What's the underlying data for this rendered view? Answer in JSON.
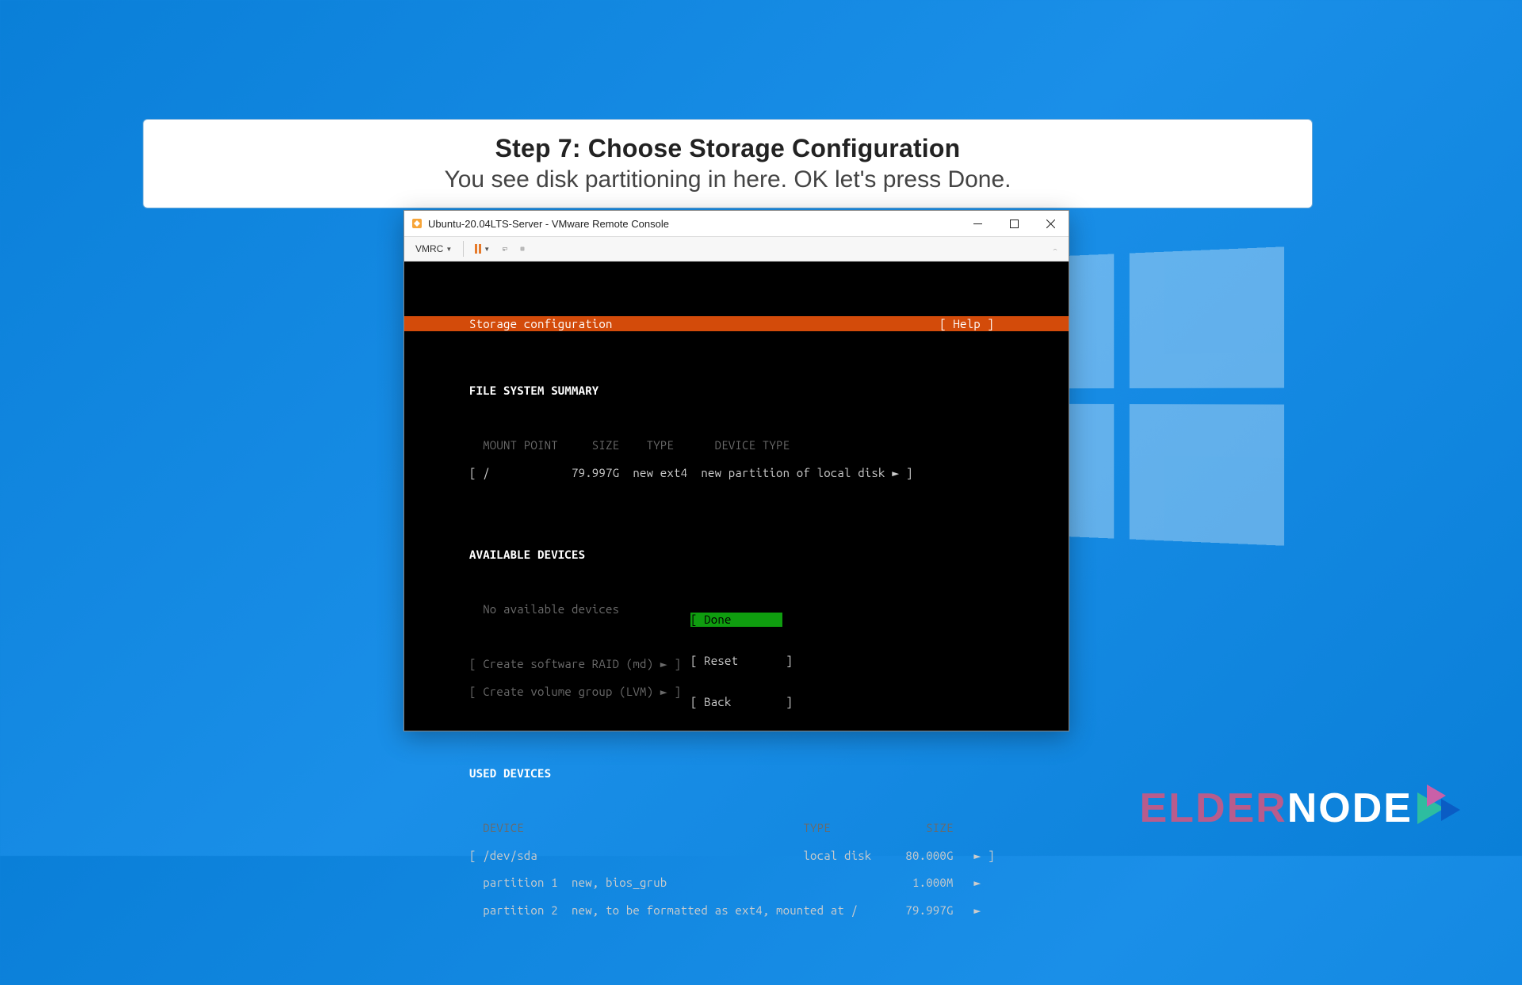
{
  "banner": {
    "title": "Step 7: Choose Storage Configuration",
    "subtitle": "You see disk partitioning in here. OK let's press Done."
  },
  "window": {
    "title": "Ubuntu-20.04LTS-Server - VMware Remote Console",
    "toolbar": {
      "vmrc": "VMRC"
    }
  },
  "installer": {
    "header_title": "Storage configuration",
    "help": "[ Help ]",
    "fs_summary_title": "FILE SYSTEM SUMMARY",
    "fs_headers": "  MOUNT POINT     SIZE    TYPE      DEVICE TYPE",
    "fs_row": "[ /            79.997G  new ext4  new partition of local disk ► ]",
    "avail_title": "AVAILABLE DEVICES",
    "avail_none": "  No available devices",
    "raid": "[ Create software RAID (md) ► ]",
    "lvm": "[ Create volume group (LVM) ► ]",
    "used_title": "USED DEVICES",
    "used_headers": "  DEVICE                                         TYPE              SIZE",
    "used_r1": "[ /dev/sda                                       local disk     80.000G   ► ]",
    "used_r2": "  partition 1  new, bios_grub                                    1.000M   ►",
    "used_r3": "  partition 2  new, to be formatted as ext4, mounted at /       79.997G   ►",
    "btn_done": "[ Done        ]",
    "btn_reset": "[ Reset       ]",
    "btn_back": "[ Back        ]"
  },
  "logo": {
    "part1": "ELDER",
    "part2": "NODE"
  }
}
